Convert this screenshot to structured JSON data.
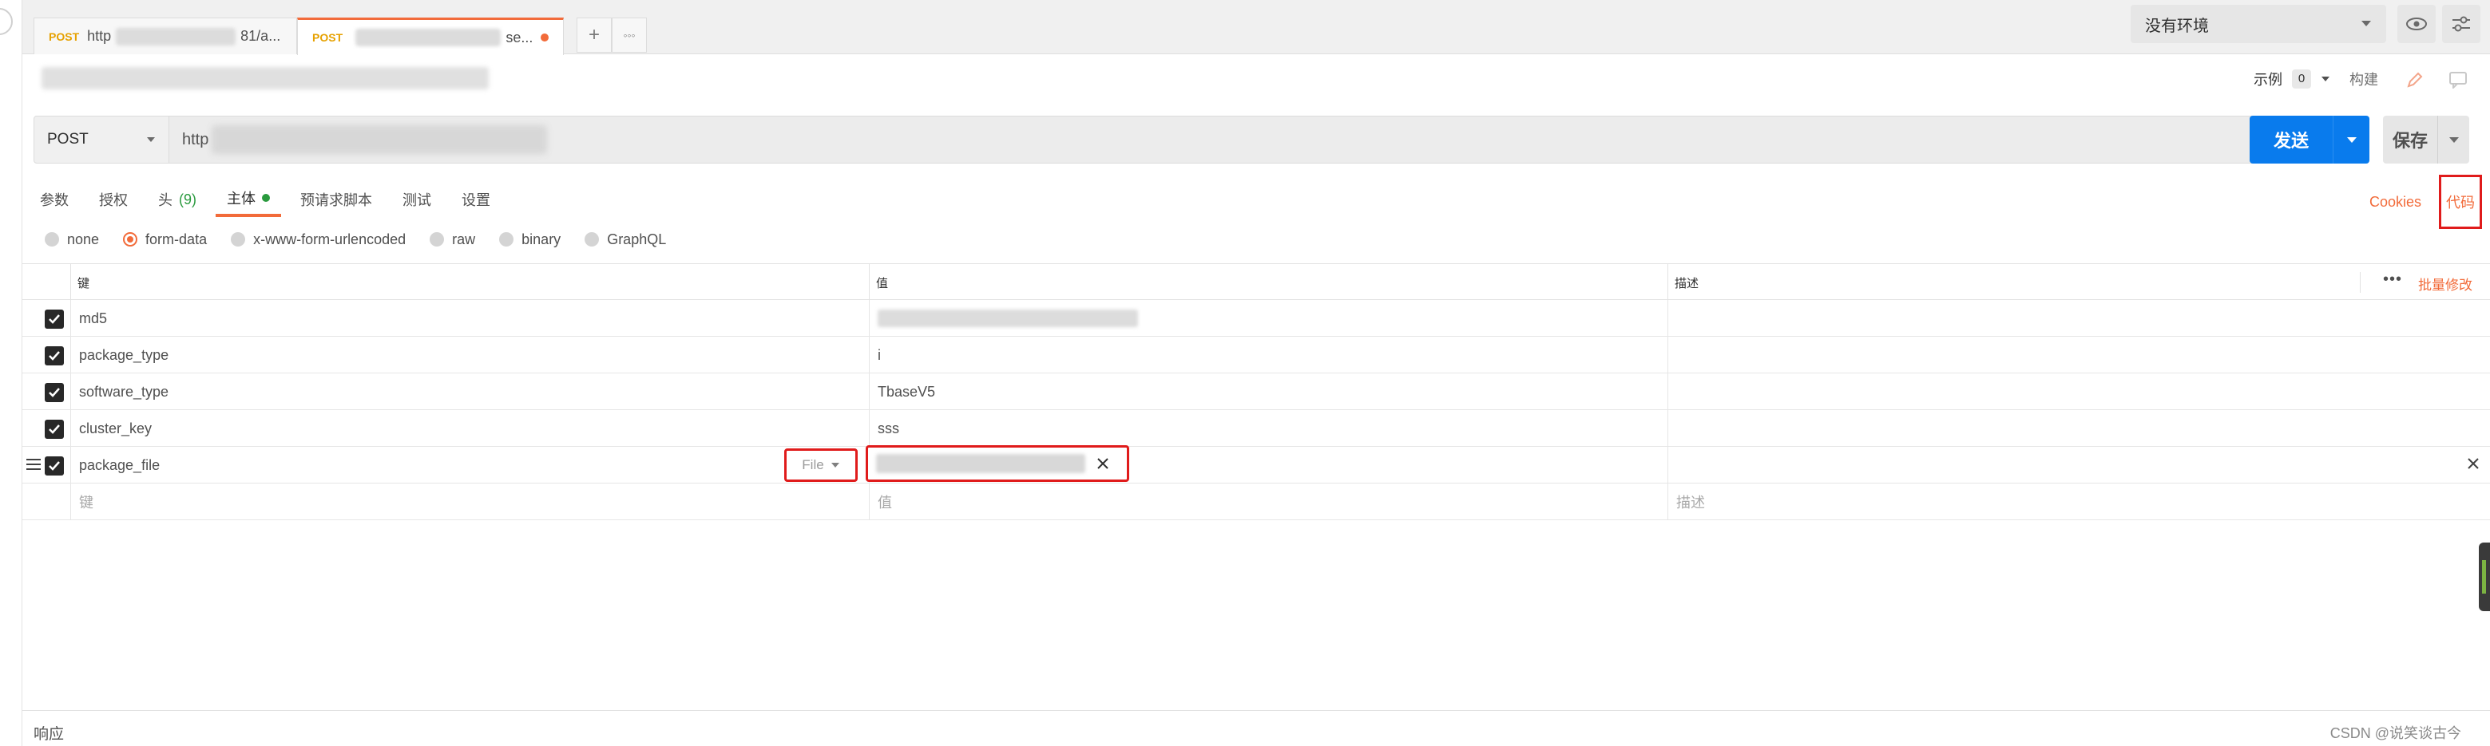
{
  "tabs": [
    {
      "method": "POST",
      "prefix": "http",
      "suffix": "81/a..."
    },
    {
      "method": "POST",
      "suffix": "se..."
    }
  ],
  "tab_actions": {
    "new_tab": "+",
    "more": "◦◦◦"
  },
  "environment": {
    "selected": "没有环境"
  },
  "title_bar": {
    "examples_label": "示例",
    "examples_count": "0",
    "build_label": "构建"
  },
  "request": {
    "method": "POST",
    "url_prefix": "http",
    "send_label": "发送",
    "save_label": "保存"
  },
  "sub_tabs": [
    {
      "label": "参数"
    },
    {
      "label": "授权"
    },
    {
      "label": "头",
      "count": "(9)"
    },
    {
      "label": "主体"
    },
    {
      "label": "预请求脚本"
    },
    {
      "label": "测试"
    },
    {
      "label": "设置"
    }
  ],
  "right_links": {
    "cookies": "Cookies",
    "code": "代码"
  },
  "body_types": [
    "none",
    "form-data",
    "x-www-form-urlencoded",
    "raw",
    "binary",
    "GraphQL"
  ],
  "body_type_selected": "form-data",
  "table": {
    "headers": {
      "key": "键",
      "value": "值",
      "description": "描述",
      "bulk_edit": "批量修改",
      "more": "•••"
    },
    "rows": [
      {
        "key": "md5",
        "value": ""
      },
      {
        "key": "package_type",
        "value": "i"
      },
      {
        "key": "software_type",
        "value": "TbaseV5"
      },
      {
        "key": "cluster_key",
        "value": "sss"
      },
      {
        "key": "package_file",
        "value": "",
        "type": "File"
      }
    ],
    "placeholder": {
      "key": "键",
      "value": "值",
      "description": "描述"
    }
  },
  "response": {
    "label": "响应"
  },
  "watermark": "CSDN @说笑谈古今",
  "colors": {
    "accent": "#f26b3a",
    "send": "#097bed",
    "highlight": "#e01b1b",
    "green": "#2a9a3e"
  }
}
